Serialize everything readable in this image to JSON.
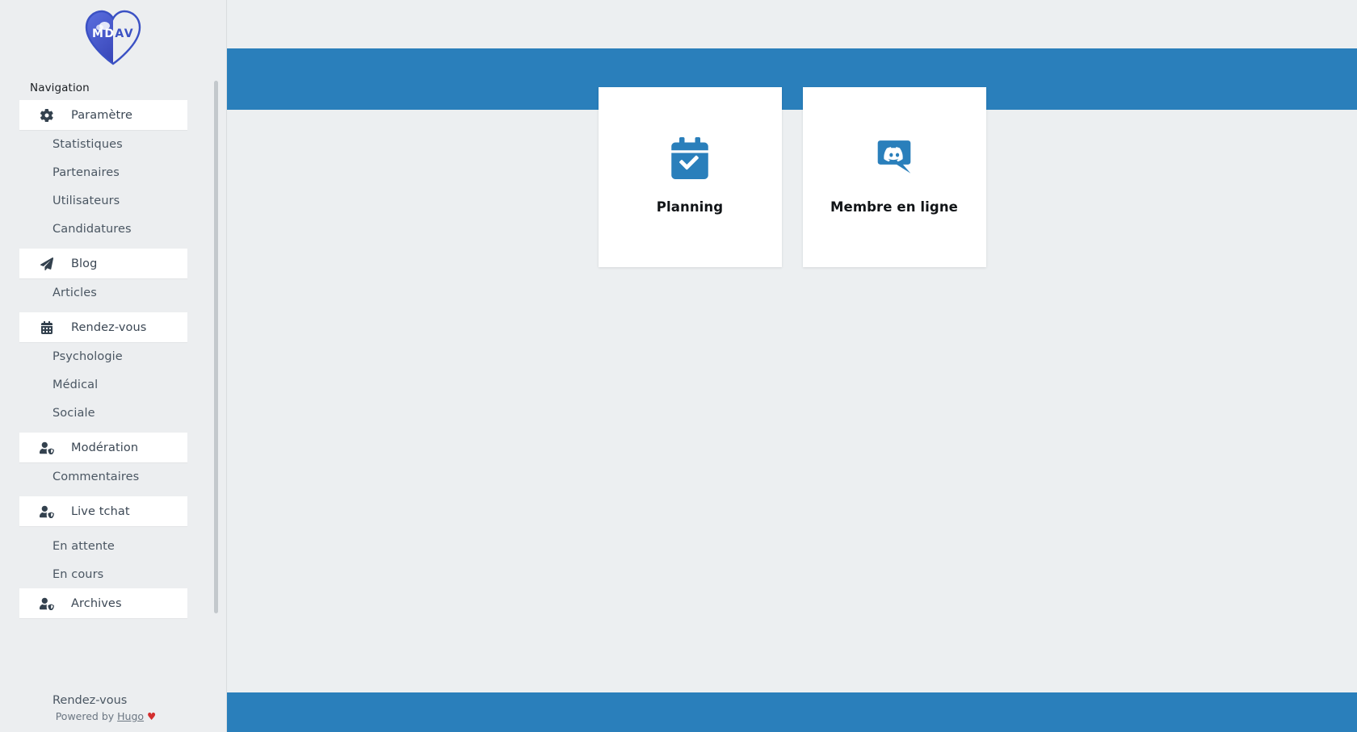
{
  "brand": {
    "logo_text": "MDAV",
    "logo_color": "#3b51c4",
    "logo_name": "mdav-heart-logo"
  },
  "theme": {
    "accent_blue": "#2a7fbb",
    "sidebar_bg": "#eceef0",
    "content_bg": "#eceff1",
    "nav_text": "#4a5662",
    "icon_color": "#33414e",
    "heart_red": "#d32f2f"
  },
  "sidebar": {
    "nav_label": "Navigation",
    "groups": [
      {
        "section": {
          "label": "Paramètre",
          "icon": "gear-icon"
        },
        "items": [
          {
            "label": "Statistiques"
          },
          {
            "label": "Partenaires"
          },
          {
            "label": "Utilisateurs"
          },
          {
            "label": "Candidatures"
          }
        ]
      },
      {
        "section": {
          "label": "Blog",
          "icon": "paper-plane-icon"
        },
        "items": [
          {
            "label": "Articles"
          }
        ]
      },
      {
        "section": {
          "label": "Rendez-vous",
          "icon": "calendar-icon"
        },
        "items": [
          {
            "label": "Psychologie"
          },
          {
            "label": "Médical"
          },
          {
            "label": "Sociale"
          }
        ]
      },
      {
        "section": {
          "label": "Modération",
          "icon": "user-shield-icon"
        },
        "items": [
          {
            "label": "Commentaires"
          }
        ]
      },
      {
        "section": {
          "label": "Live tchat",
          "icon": "user-shield-icon"
        },
        "items": [
          {
            "label": "En attente"
          },
          {
            "label": "En cours"
          }
        ]
      },
      {
        "section": {
          "label": "Archives",
          "icon": "user-shield-icon"
        },
        "items": []
      }
    ],
    "footer": {
      "line1": "Rendez-vous",
      "powered_prefix": "Powered by ",
      "powered_link": "Hugo",
      "heart": "♥"
    }
  },
  "main": {
    "cards": [
      {
        "title": "Planning",
        "icon": "calendar-check-icon"
      },
      {
        "title": "Membre en ligne",
        "icon": "discord-icon"
      }
    ]
  }
}
